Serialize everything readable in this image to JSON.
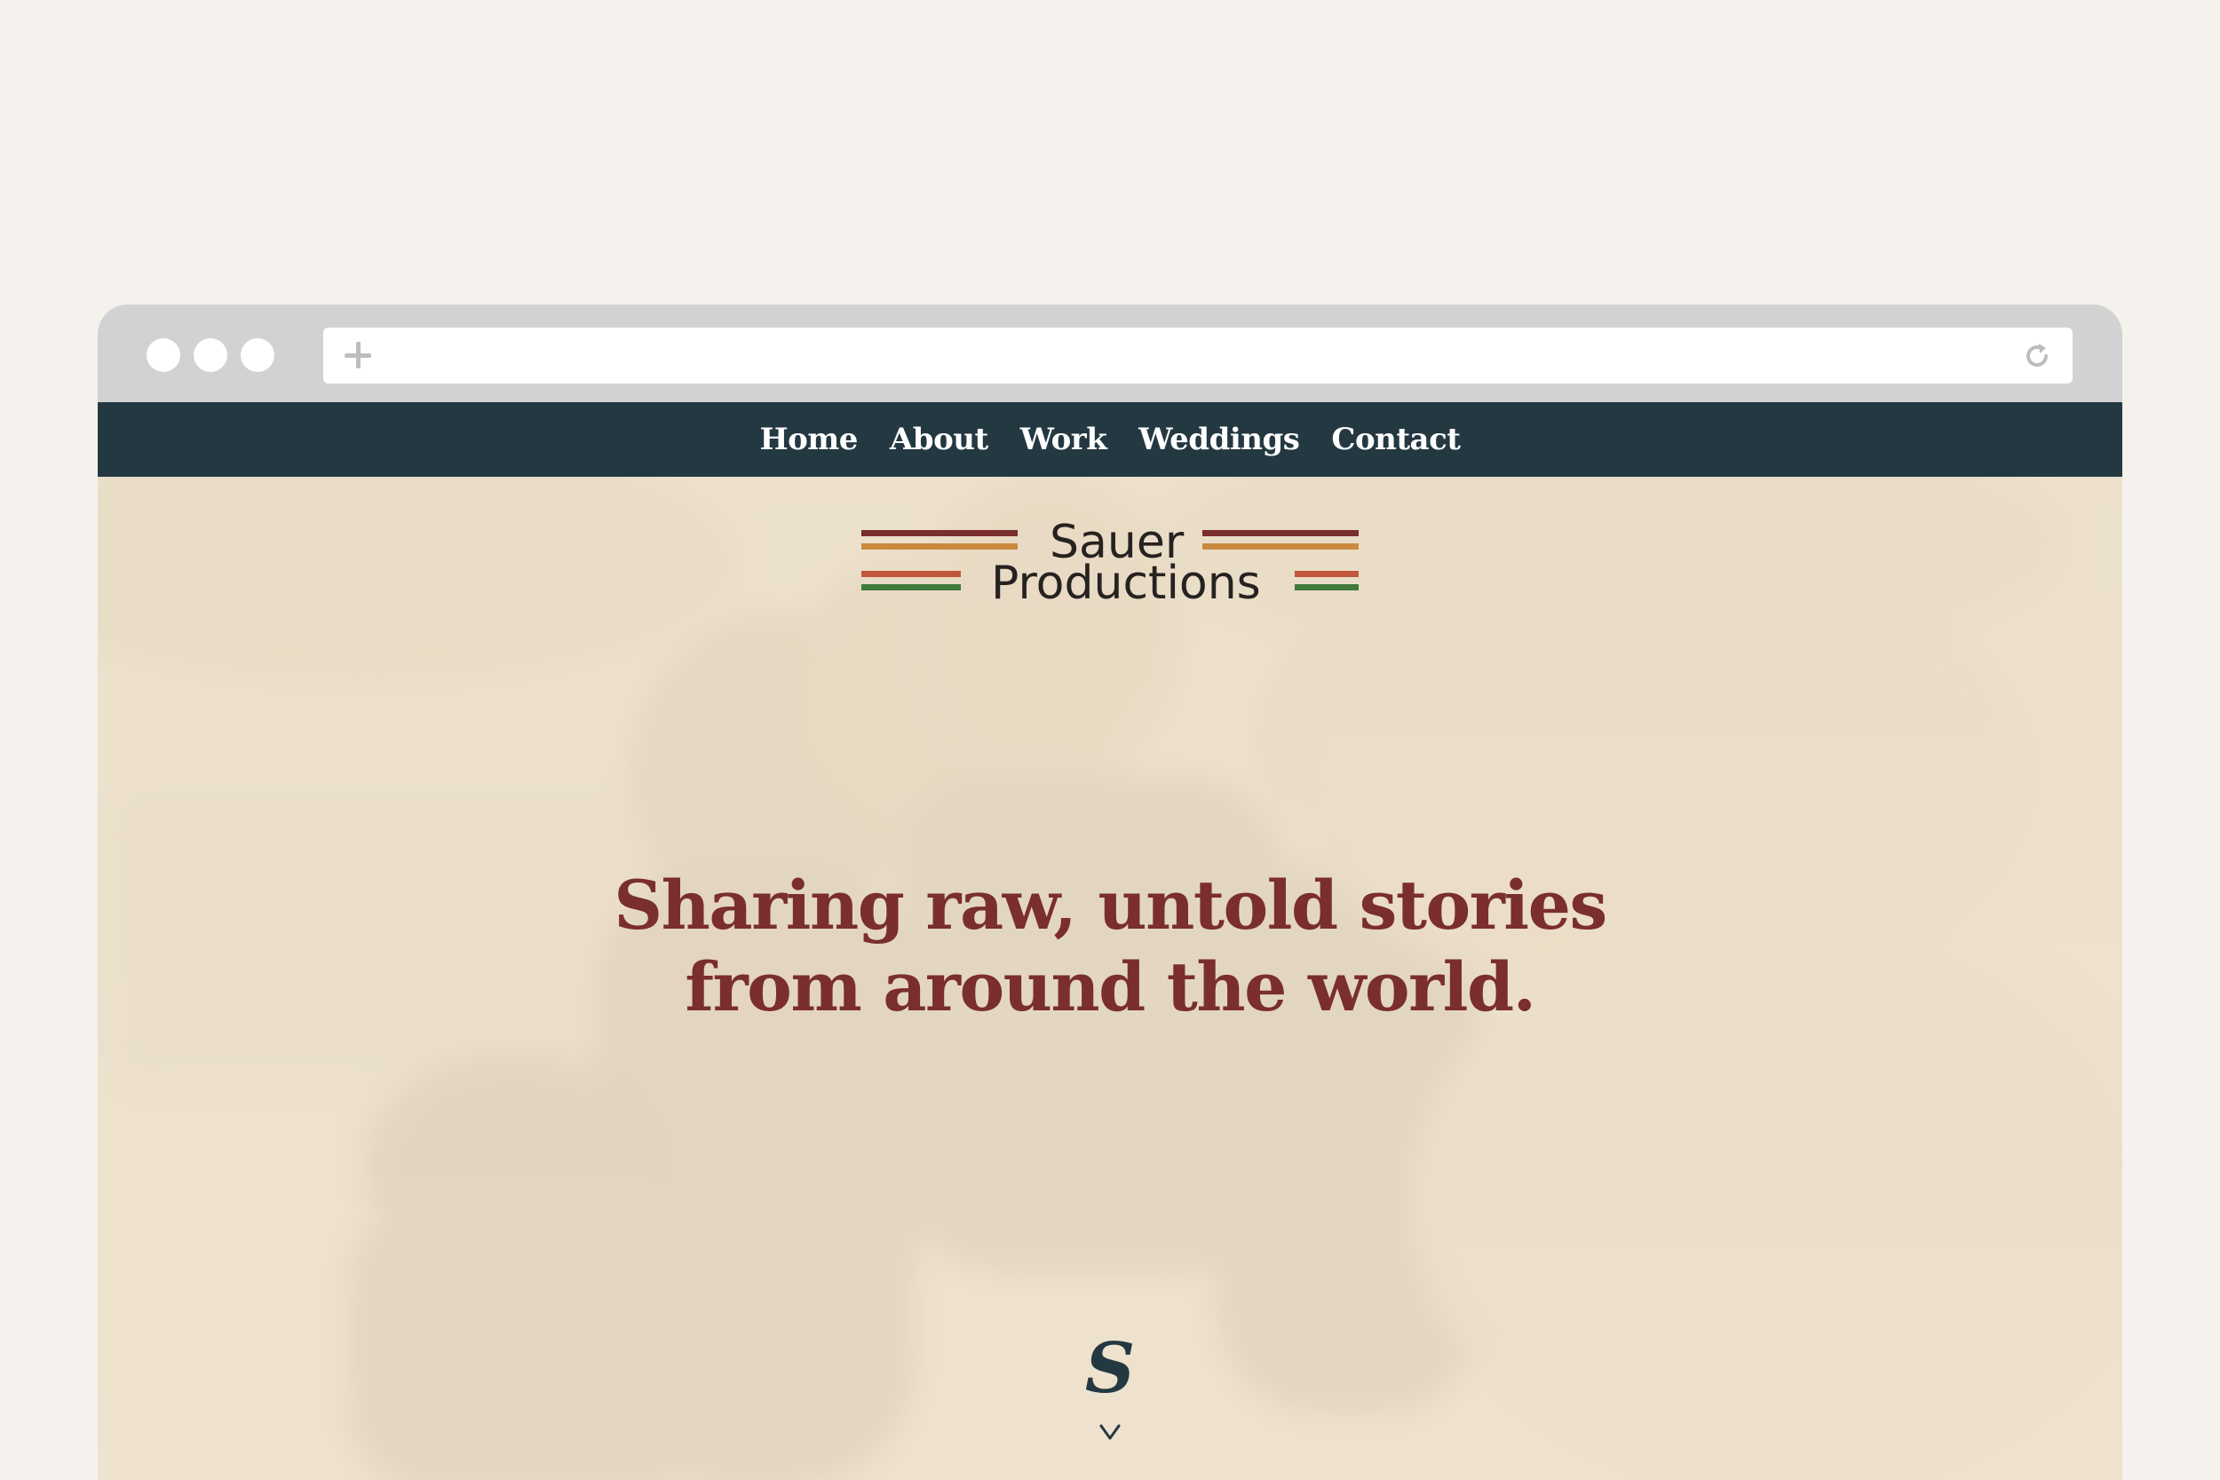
{
  "browser": {
    "window_controls": [
      "close",
      "minimize",
      "maximize"
    ],
    "address_bar": {
      "value": "",
      "new_tab_icon": "plus-icon",
      "reload_icon": "reload-icon"
    }
  },
  "nav": {
    "items": [
      {
        "label": "Home"
      },
      {
        "label": "About"
      },
      {
        "label": "Work"
      },
      {
        "label": "Weddings"
      },
      {
        "label": "Contact"
      }
    ],
    "background": "#243842",
    "text_color": "#ffffff"
  },
  "logo": {
    "line1": "Sauer",
    "line2": "Productions",
    "stripe_colors": [
      "#7a2e2e",
      "#c98a3e",
      "#c0573a",
      "#3e7a3d"
    ]
  },
  "hero": {
    "headline_line1": "Sharing raw, untold stories",
    "headline_line2": "from around the world.",
    "headline_color": "#7a2e2e",
    "overlay_color": "#efe2cd"
  },
  "footer_mark": {
    "monogram": "S",
    "scroll_icon": "chevron-down-icon"
  }
}
